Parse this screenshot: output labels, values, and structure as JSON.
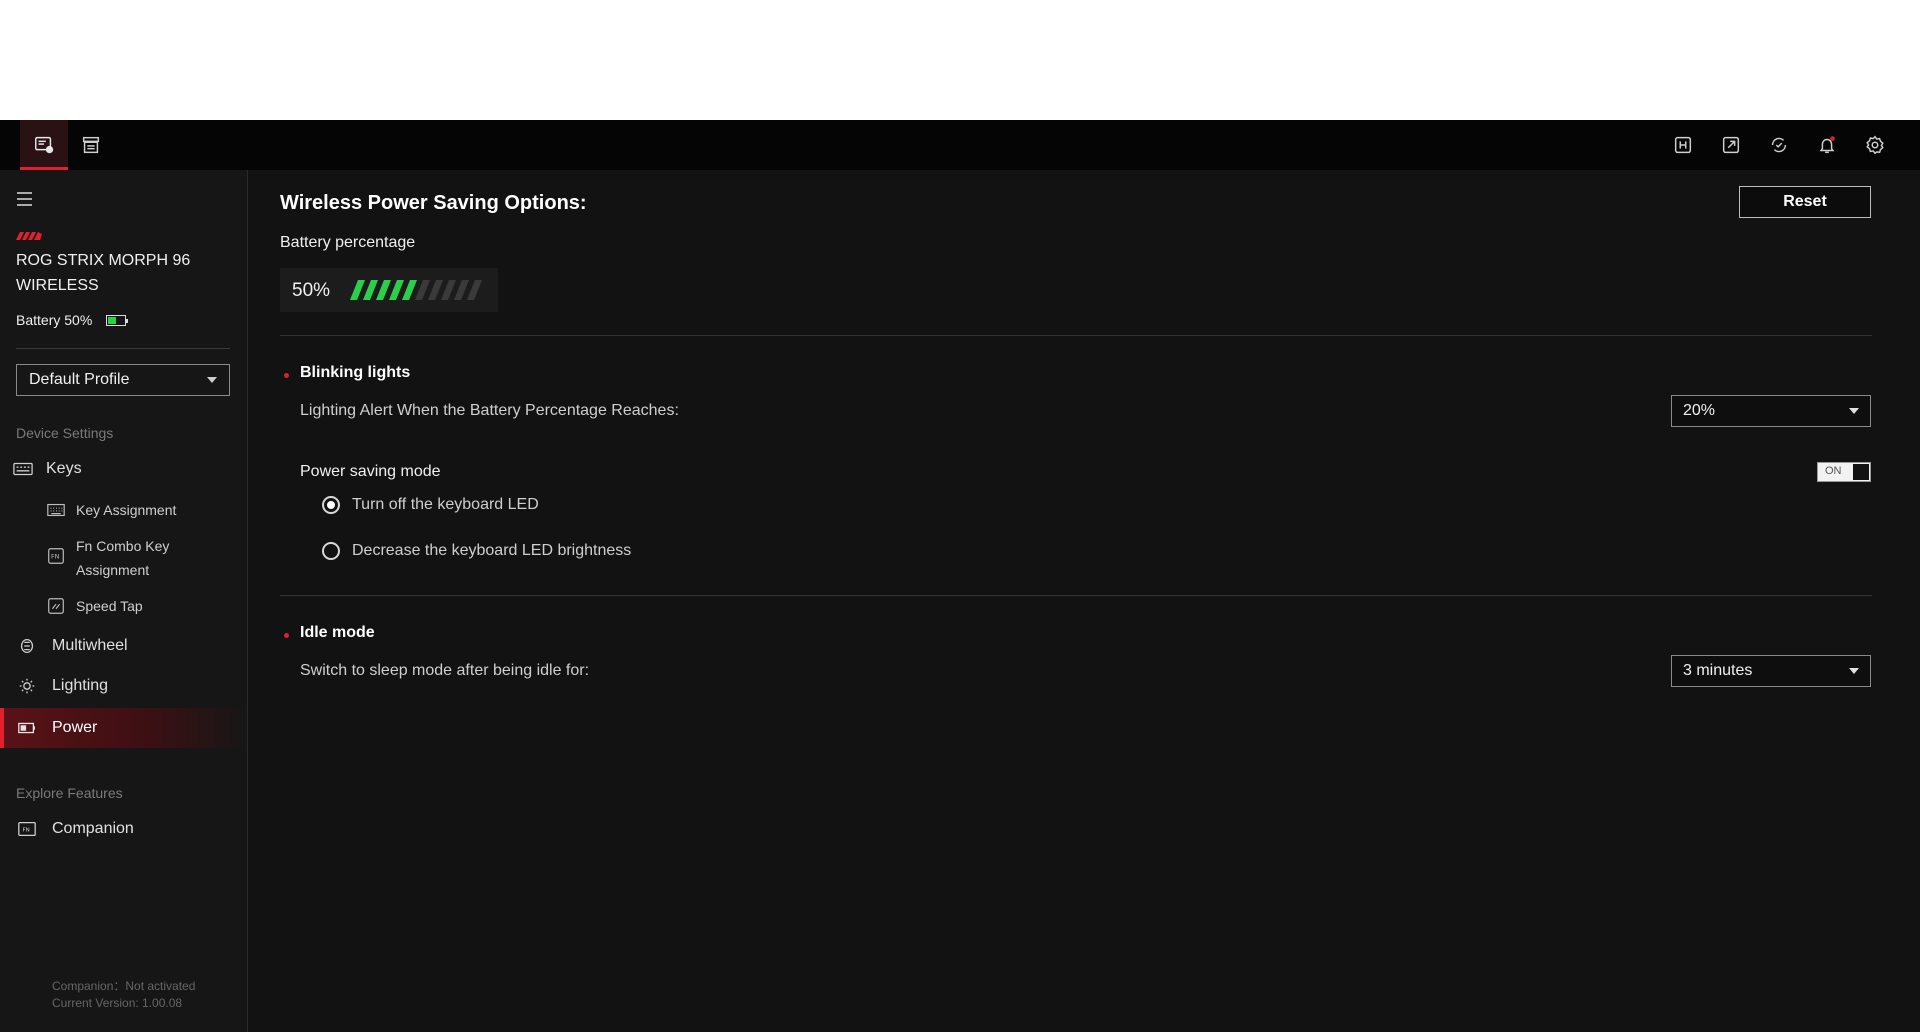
{
  "device": {
    "name_line1": "ROG STRIX MORPH 96",
    "name_line2": "WIRELESS",
    "battery_text": "Battery 50%",
    "battery_level": 0.5
  },
  "profile": {
    "selected": "Default Profile"
  },
  "sidebar": {
    "device_settings_label": "Device Settings",
    "items": [
      {
        "label": "Keys",
        "icon": "keyboard-icon"
      },
      {
        "label": "Key Assignment",
        "icon": "keyboard-small-icon"
      },
      {
        "label": "Fn Combo Key",
        "label2": "Assignment",
        "icon": "fn-key-icon"
      },
      {
        "label": "Speed Tap",
        "icon": "speed-tap-icon"
      },
      {
        "label": "Multiwheel",
        "icon": "multiwheel-icon"
      },
      {
        "label": "Lighting",
        "icon": "lighting-icon"
      },
      {
        "label": "Power",
        "icon": "battery-icon",
        "active": true
      }
    ],
    "explore_label": "Explore Features",
    "companion_label": "Companion",
    "footer_line1": "Companion：Not activated",
    "footer_line2": "Current Version: 1.00.08"
  },
  "main": {
    "title": "Wireless Power Saving Options:",
    "reset_label": "Reset",
    "battery_label": "Battery percentage",
    "battery_value": "50%",
    "battery_bars_total": 10,
    "battery_bars_filled": 5,
    "blinking": {
      "title": "Blinking lights",
      "alert_label": "Lighting Alert When the Battery Percentage Reaches:",
      "alert_value": "20%"
    },
    "power_saving": {
      "title": "Power saving mode",
      "toggle": "ON",
      "option1": "Turn off the keyboard LED",
      "option2": "Decrease the keyboard LED brightness",
      "selected": 1
    },
    "idle": {
      "title": "Idle mode",
      "label": "Switch to sleep mode after being idle for:",
      "value": "3 minutes"
    }
  },
  "colors": {
    "accent": "#e0202c",
    "battery_green": "#29d14a",
    "bg": "#121212"
  }
}
